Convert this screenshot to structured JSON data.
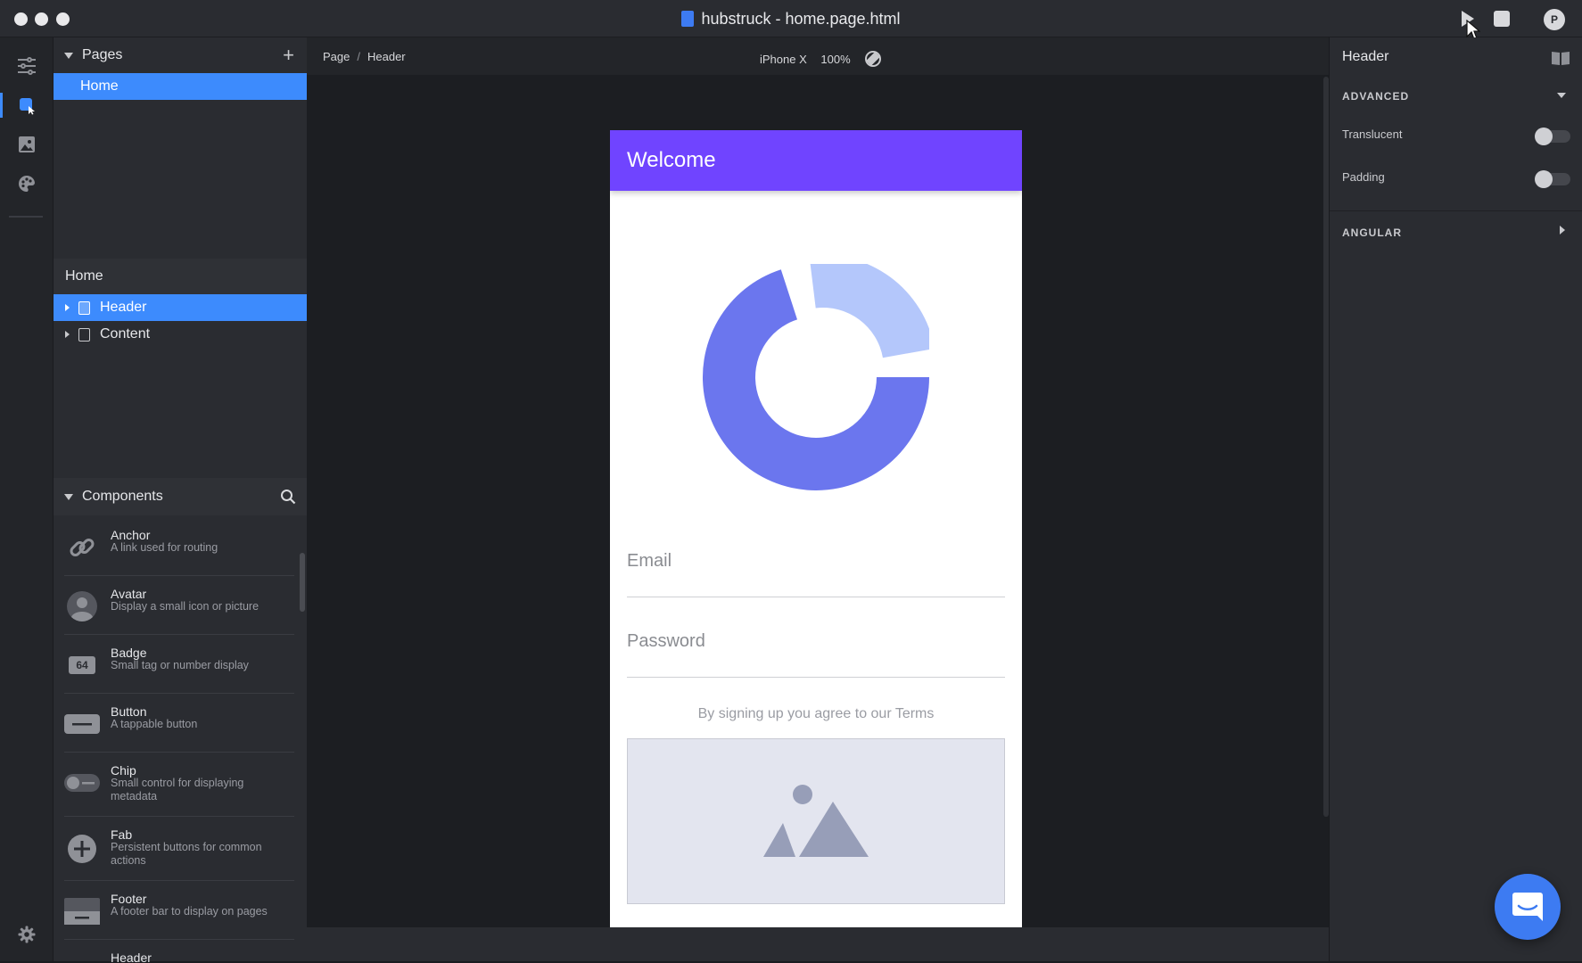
{
  "window": {
    "title": "hubstruck - home.page.html"
  },
  "titlebar": {
    "avatar_initial": "P"
  },
  "pages": {
    "heading": "Pages",
    "items": [
      {
        "label": "Home",
        "selected": true
      }
    ]
  },
  "tree": {
    "heading": "Home",
    "items": [
      {
        "label": "Header",
        "selected": true
      },
      {
        "label": "Content",
        "selected": false
      }
    ]
  },
  "components": {
    "heading": "Components",
    "items": [
      {
        "name": "Anchor",
        "desc": "A link used for routing",
        "icon": "link-icon"
      },
      {
        "name": "Avatar",
        "desc": "Display a small icon or picture",
        "icon": "avatar-icon"
      },
      {
        "name": "Badge",
        "desc": "Small tag or number display",
        "icon": "badge-icon",
        "badge_text": "64"
      },
      {
        "name": "Button",
        "desc": "A tappable button",
        "icon": "button-icon"
      },
      {
        "name": "Chip",
        "desc": "Small control for displaying metadata",
        "icon": "chip-icon"
      },
      {
        "name": "Fab",
        "desc": "Persistent buttons for common actions",
        "icon": "fab-icon"
      },
      {
        "name": "Footer",
        "desc": "A footer bar to display on pages",
        "icon": "footer-icon"
      },
      {
        "name": "Header",
        "desc": "",
        "icon": "header-icon"
      }
    ]
  },
  "canvas": {
    "breadcrumb": {
      "root": "Page",
      "separator": "/",
      "current": "Header"
    },
    "device": "iPhone X",
    "zoom": "100%"
  },
  "phone": {
    "header_title": "Welcome",
    "email_label": "Email",
    "password_label": "Password",
    "terms_text": "By signing up you agree to our Terms"
  },
  "right_panel": {
    "title": "Header",
    "advanced_label": "ADVANCED",
    "translucent_label": "Translucent",
    "translucent_on": false,
    "padding_label": "Padding",
    "padding_on": false,
    "angular_label": "ANGULAR"
  },
  "colors": {
    "accent": "#3d8bfd",
    "header_purple": "#7044ff",
    "donut_dark": "#6b76ee",
    "donut_light": "#b4c7fb"
  }
}
